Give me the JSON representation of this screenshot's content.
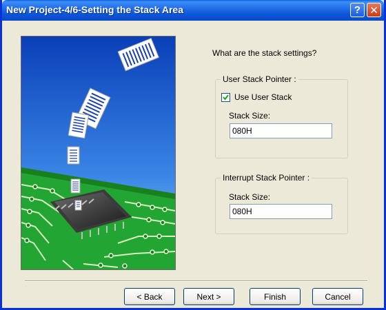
{
  "window": {
    "title": "New Project-4/6-Setting the Stack Area",
    "help_label": "?",
    "close_label": "✕"
  },
  "prompt": "What are the stack settings?",
  "user_stack": {
    "group_label": "User Stack Pointer :",
    "checkbox_label": "Use User Stack",
    "checked": true,
    "size_label": "Stack Size:",
    "size_value": "080H"
  },
  "interrupt_stack": {
    "group_label": "Interrupt Stack Pointer :",
    "size_label": "Stack Size:",
    "size_value": "080H"
  },
  "buttons": {
    "back": "< Back",
    "next": "Next >",
    "finish": "Finish",
    "cancel": "Cancel"
  },
  "colors": {
    "titlebar": "#0a55d8",
    "dialog_bg": "#ece9d8",
    "sky": "#2f6fd8",
    "board": "#1fa32f"
  },
  "icons": {
    "illustration": "circuit-board-with-flying-documents"
  }
}
